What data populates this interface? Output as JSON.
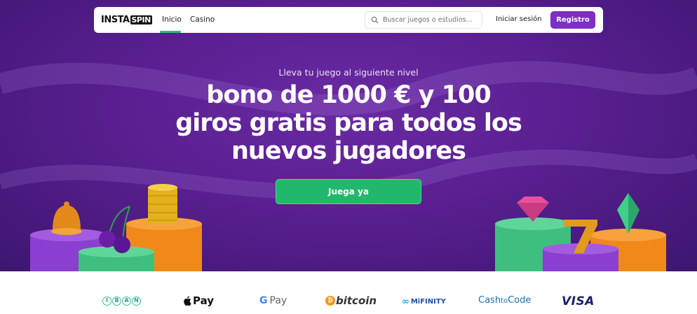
{
  "header": {
    "logo_text_a": "INSTA",
    "logo_text_b": "SPIN",
    "nav": [
      {
        "label": "Inicio",
        "active": true
      },
      {
        "label": "Casino",
        "active": false
      }
    ],
    "search": {
      "placeholder": "Buscar juegos o estudios..."
    },
    "login_label": "Iniciar sesión",
    "register_label": "Registro"
  },
  "hero": {
    "subtitle": "Lleva tu juego al siguiente nivel",
    "headline": "bono de 1000 € y 100 giros gratis para todos los nuevos jugadores",
    "cta_label": "Juega ya"
  },
  "payments": {
    "iban": [
      "I",
      "B",
      "A",
      "N"
    ],
    "apple_pay": "Pay",
    "google_pay_g": "G",
    "google_pay": "Pay",
    "bitcoin": "bitcoin",
    "mifinity": "MiFINITY",
    "cashtocode_a": "Cash",
    "cashtocode_b": "to",
    "cashtocode_c": "Code",
    "visa": "VISA"
  },
  "colors": {
    "hero_purple": "#5a1f91",
    "brand_purple": "#7d2ec4",
    "accent_green": "#22b86b"
  }
}
